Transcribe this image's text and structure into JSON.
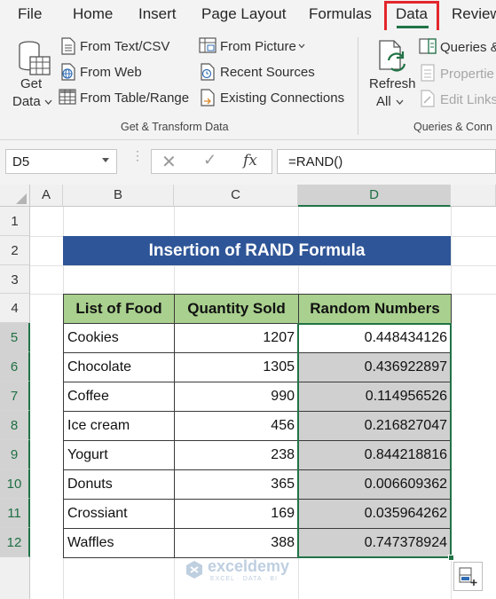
{
  "menu": {
    "items": [
      "File",
      "Home",
      "Insert",
      "Page Layout",
      "Formulas",
      "Data",
      "Review"
    ],
    "active": "Data"
  },
  "ribbon": {
    "get_data": {
      "line1": "Get",
      "line2": "Data"
    },
    "from_text_csv": "From Text/CSV",
    "from_web": "From Web",
    "from_table_range": "From Table/Range",
    "from_picture": "From Picture",
    "recent_sources": "Recent Sources",
    "existing_connections": "Existing Connections",
    "group_get_transform": "Get & Transform Data",
    "refresh": {
      "line1": "Refresh",
      "line2": "All"
    },
    "queries": "Queries &",
    "properties": "Propertie",
    "edit_links": "Edit Links",
    "group_queries": "Queries & Conn"
  },
  "formula_bar": {
    "name_box": "D5",
    "fx_label": "fx",
    "formula": "=RAND()"
  },
  "grid": {
    "columns": [
      "A",
      "B",
      "C",
      "D"
    ],
    "rows": [
      "1",
      "2",
      "3",
      "4",
      "5",
      "6",
      "7",
      "8",
      "9",
      "10",
      "11",
      "12"
    ],
    "selected_column": "D",
    "title": "Insertion of RAND Formula",
    "table": {
      "headers": [
        "List of Food",
        "Quantity Sold",
        "Random Numbers"
      ],
      "rows": [
        [
          "Cookies",
          "1207",
          "0.448434126"
        ],
        [
          "Chocolate",
          "1305",
          "0.436922897"
        ],
        [
          "Coffee",
          "990",
          "0.114956526"
        ],
        [
          "Ice cream",
          "456",
          "0.216827047"
        ],
        [
          "Yogurt",
          "238",
          "0.844218816"
        ],
        [
          "Donuts",
          "365",
          "0.006609362"
        ],
        [
          "Crossiant",
          "169",
          "0.035964262"
        ],
        [
          "Waffles",
          "388",
          "0.747378924"
        ]
      ]
    }
  },
  "watermark": {
    "name": "exceldemy",
    "tagline": "EXCEL · DATA · BI"
  },
  "colors": {
    "accent": "#217346",
    "title_fill": "#2e5597",
    "header_fill": "#a9d08e",
    "highlight": "#e3262c",
    "selection_shade": "#d0d0d0"
  }
}
